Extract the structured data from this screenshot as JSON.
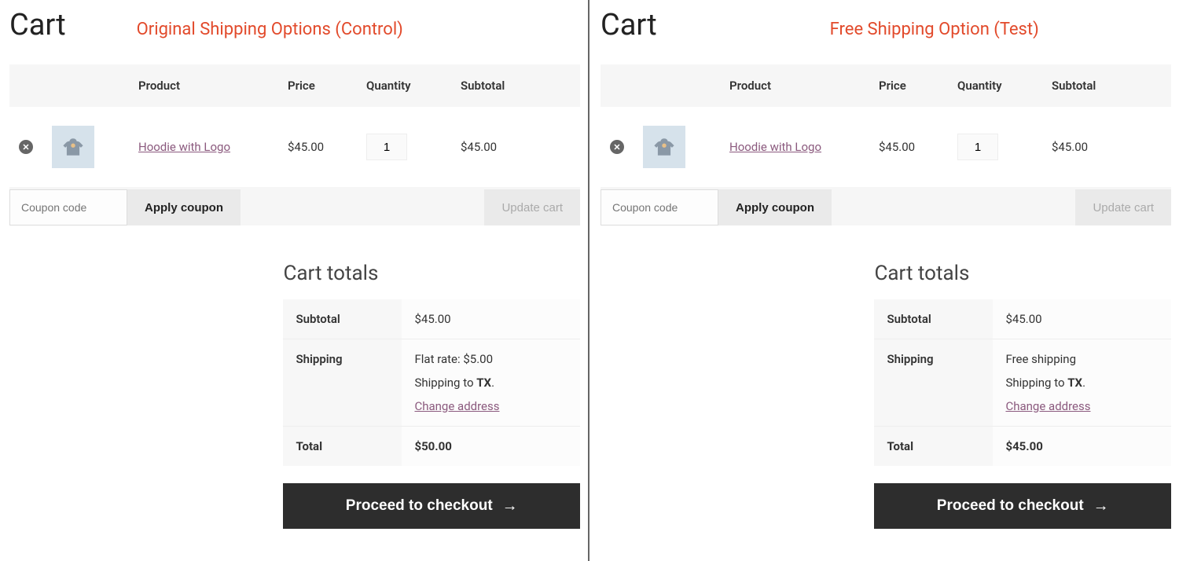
{
  "left": {
    "page_title": "Cart",
    "variant": "Original Shipping Options (Control)",
    "table": {
      "headers": {
        "product": "Product",
        "price": "Price",
        "quantity": "Quantity",
        "subtotal": "Subtotal"
      },
      "row": {
        "product_name": "Hoodie with Logo",
        "price": "$45.00",
        "quantity": "1",
        "subtotal": "$45.00"
      }
    },
    "coupon": {
      "placeholder": "Coupon code",
      "apply_label": "Apply coupon"
    },
    "update_cart_label": "Update cart",
    "totals": {
      "title": "Cart totals",
      "subtotal_label": "Subtotal",
      "subtotal_value": "$45.00",
      "shipping_label": "Shipping",
      "shipping_method": "Flat rate: $5.00",
      "shipping_to_prefix": "Shipping to ",
      "shipping_to_region": "TX",
      "shipping_to_suffix": ".",
      "change_address": "Change address",
      "total_label": "Total",
      "total_value": "$50.00"
    },
    "checkout_label": "Proceed to checkout"
  },
  "right": {
    "page_title": "Cart",
    "variant": "Free Shipping Option (Test)",
    "table": {
      "headers": {
        "product": "Product",
        "price": "Price",
        "quantity": "Quantity",
        "subtotal": "Subtotal"
      },
      "row": {
        "product_name": "Hoodie with Logo",
        "price": "$45.00",
        "quantity": "1",
        "subtotal": "$45.00"
      }
    },
    "coupon": {
      "placeholder": "Coupon code",
      "apply_label": "Apply coupon"
    },
    "update_cart_label": "Update cart",
    "totals": {
      "title": "Cart totals",
      "subtotal_label": "Subtotal",
      "subtotal_value": "$45.00",
      "shipping_label": "Shipping",
      "shipping_method": "Free shipping",
      "shipping_to_prefix": "Shipping to ",
      "shipping_to_region": "TX",
      "shipping_to_suffix": ".",
      "change_address": "Change address",
      "total_label": "Total",
      "total_value": "$45.00"
    },
    "checkout_label": "Proceed to checkout"
  }
}
